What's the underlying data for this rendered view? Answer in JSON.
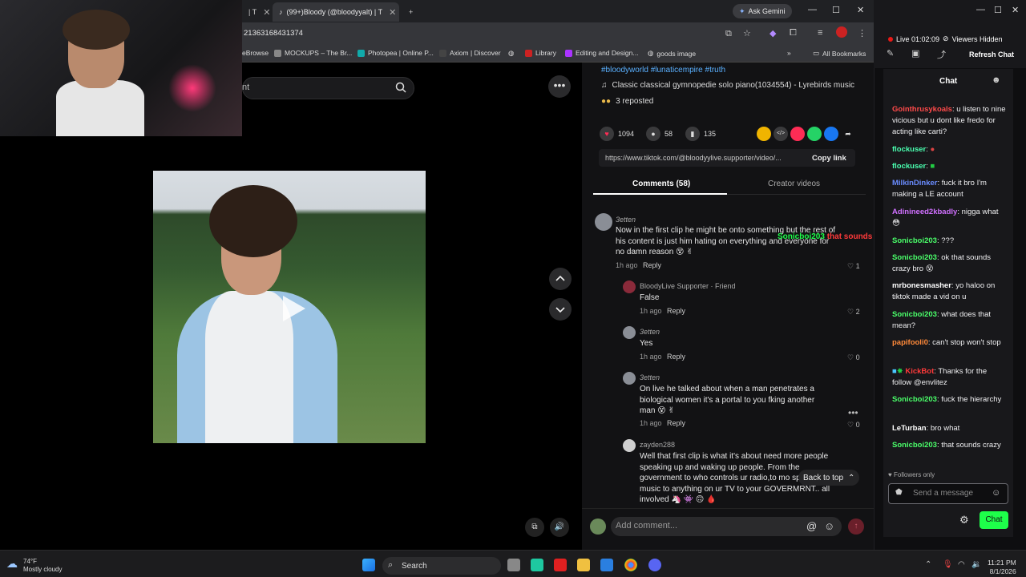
{
  "browser": {
    "tabs": [
      {
        "label": "| T",
        "active": false
      },
      {
        "label": "(99+)Bloody (@bloodyyalt) | T",
        "active": true
      }
    ],
    "ask_gemini": "Ask Gemini",
    "url": "21363168431374",
    "bookmarks": [
      "eBrowse",
      "MOCKUPS – The Br...",
      "Photopea | Online P...",
      "Axiom | Discover",
      "Library",
      "Editing and Design...",
      "goods image"
    ],
    "all_bookmarks": "All Bookmarks"
  },
  "page": {
    "search_partial": "nt",
    "description": {
      "hashtags": "#bloodyworld #lunaticempire #truth",
      "music": "Classic classical gymnopedie solo piano(1034554) - Lyrebirds music",
      "reposted": "3 reposted"
    },
    "actions": {
      "likes": "1094",
      "comments": "58",
      "saves": "135"
    },
    "share_link": "https://www.tiktok.com/@bloodyylive.supporter/video/...",
    "copy_link": "Copy link",
    "tabs": {
      "comments": "Comments (58)",
      "creator": "Creator videos"
    },
    "comments": [
      {
        "user": "3etten",
        "text": "Now in the first clip he might be onto something but the rest of his content is just him hating on everything and everyone for no damn reason 😵 ✌",
        "time": "1h ago",
        "reply": "Reply",
        "likes": "1"
      },
      {
        "user": "BloodyLive Supporter · Friend",
        "text": "False",
        "time": "1h ago",
        "reply": "Reply",
        "likes": "2"
      },
      {
        "user": "3etten",
        "text": "Yes",
        "time": "1h ago",
        "reply": "Reply",
        "likes": "0"
      },
      {
        "user": "3etten",
        "text": "On live he talked about when a man penetrates a biological women it's a portal to you fking another man 😵 ✌",
        "time": "1h ago",
        "reply": "Reply",
        "likes": "0"
      },
      {
        "user": "zayden288",
        "text": "Well that first clip is what it's about need more people speaking up and waking up people. From the government to who controls ur radio,to mo sports to music to anything on ur TV to your GOVERMRNT.. all involved 🦄 👾 🙃 🩸"
      }
    ],
    "back_to_top": "Back to top",
    "add_comment": "Add comment...",
    "overlay_user": "Sonicboi203",
    "overlay_text": "that sounds crazy"
  },
  "twitch": {
    "live": "Live 01:02:09",
    "viewers": "Viewers Hidden",
    "refresh": "Refresh Chat",
    "chat_title": "Chat",
    "messages": [
      {
        "user": "Gointhrusykoals",
        "text": "u listen to nine vicious but u dont like fredo for acting like carti?",
        "color": "#ff4a4a"
      },
      {
        "user": "flockuser",
        "text": "",
        "color": "#4affb0"
      },
      {
        "user": "flockuser",
        "text": "",
        "color": "#4affb0"
      },
      {
        "user": "MilkinDinker",
        "text": "fuck it bro I'm making a LE account",
        "color": "#6a8cff"
      },
      {
        "user": "Adinineed2kbadly",
        "text": "nigga what 😳",
        "color": "#d070ff"
      },
      {
        "user": "Sonicboi203",
        "text": "???",
        "color": "#4aff6a"
      },
      {
        "user": "Sonicboi203",
        "text": "ok that sounds crazy bro 😵",
        "color": "#4aff6a"
      },
      {
        "user": "mrbonesmasher",
        "text": "yo haloo on tiktok made a vid on u",
        "color": "#ffffff"
      },
      {
        "user": "Sonicboi203",
        "text": "what does that mean?",
        "color": "#4aff6a"
      },
      {
        "user": "papifooli0",
        "text": "can't stop won't stop",
        "color": "#ff8a3a"
      },
      {
        "user": "KickBot",
        "text": "Thanks for the follow @envlitez",
        "color": "#ff3a3a"
      },
      {
        "user": "Sonicboi203",
        "text": "fuck the hierarchy",
        "color": "#4aff6a"
      },
      {
        "user": "LeTurban",
        "text": "bro what",
        "color": "#ffffff"
      },
      {
        "user": "Sonicboi203",
        "text": "that sounds crazy",
        "color": "#4aff6a"
      }
    ],
    "followers_only": "Followers only",
    "send_placeholder": "Send a message",
    "chat_button": "Chat"
  },
  "taskbar": {
    "weather_temp": "74°F",
    "weather_desc": "Mostly cloudy",
    "search": "Search",
    "time": "11:21 PM",
    "date": "8/1/2026"
  },
  "colors": {
    "accent_twitch": "#1eff4a",
    "tiktok_like": "#fe2c55"
  }
}
